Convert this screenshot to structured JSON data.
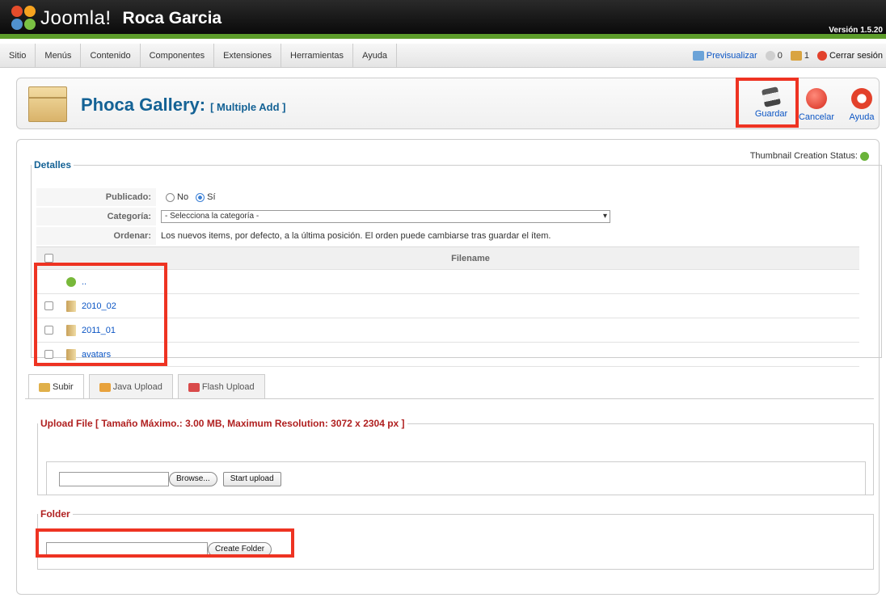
{
  "header": {
    "logo_text": "Joomla!",
    "site_name": "Roca Garcia",
    "version": "Versión 1.5.20"
  },
  "menu": {
    "items": [
      "Sitio",
      "Menús",
      "Contenido",
      "Componentes",
      "Extensiones",
      "Herramientas",
      "Ayuda"
    ],
    "preview": "Previsualizar",
    "messages_count": "0",
    "users_count": "1",
    "logout": "Cerrar sesión"
  },
  "toolbar": {
    "title": "Phoca Gallery:",
    "subtitle": "[ Multiple Add ]",
    "save": "Guardar",
    "cancel": "Cancelar",
    "help": "Ayuda"
  },
  "status": {
    "thumbnail": "Thumbnail Creation Status:"
  },
  "details": {
    "legend": "Detalles",
    "published_label": "Publicado:",
    "published_options": [
      "No",
      "Sí"
    ],
    "published_selected": "Sí",
    "category_label": "Categoría:",
    "category_value": "- Selecciona la categoría -",
    "order_label": "Ordenar:",
    "order_text": "Los nuevos items, por defecto, a la última posición. El orden puede cambiarse tras guardar el ítem."
  },
  "filetable": {
    "header": "Filename",
    "up_label": "..",
    "folders": [
      "2010_02",
      "2011_01",
      "avatars"
    ]
  },
  "tabs": {
    "items": [
      "Subir",
      "Java Upload",
      "Flash Upload"
    ],
    "active": "Subir"
  },
  "upload": {
    "legend": "Upload File [ Tamaño Máximo.: 3.00 MB, Maximum Resolution: 3072 x 2304 px ]",
    "browse": "Browse...",
    "start": "Start upload"
  },
  "folder": {
    "legend": "Folder",
    "create": "Create Folder"
  },
  "colors": {
    "accent_green": "#5c9c2a",
    "title_blue": "#146295",
    "link_blue": "#0b55c4",
    "highlight_red": "#ee3322"
  }
}
